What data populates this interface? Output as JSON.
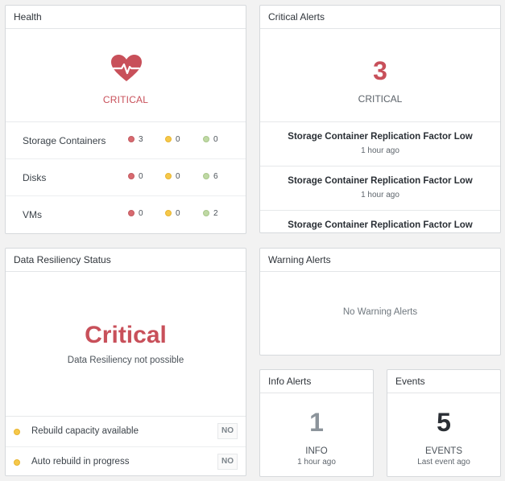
{
  "health": {
    "title": "Health",
    "status": "CRITICAL",
    "rows": [
      {
        "label": "Storage Containers",
        "critical": "3",
        "warning": "0",
        "ok": "0"
      },
      {
        "label": "Disks",
        "critical": "0",
        "warning": "0",
        "ok": "6"
      },
      {
        "label": "VMs",
        "critical": "0",
        "warning": "0",
        "ok": "2"
      }
    ]
  },
  "critical_alerts": {
    "title": "Critical Alerts",
    "count": "3",
    "count_label": "CRITICAL",
    "items": [
      {
        "title": "Storage Container Replication Factor Low",
        "time": "1 hour ago"
      },
      {
        "title": "Storage Container Replication Factor Low",
        "time": "1 hour ago"
      },
      {
        "title": "Storage Container Replication Factor Low",
        "time": ""
      }
    ]
  },
  "data_resiliency": {
    "title": "Data Resiliency Status",
    "status": "Critical",
    "subtitle": "Data Resiliency not possible",
    "rows": [
      {
        "label": "Rebuild capacity available",
        "value": "NO"
      },
      {
        "label": "Auto rebuild in progress",
        "value": "NO"
      }
    ]
  },
  "warning_alerts": {
    "title": "Warning Alerts",
    "message": "No Warning Alerts"
  },
  "info_alerts": {
    "title": "Info Alerts",
    "count": "1",
    "label": "INFO",
    "time": "1 hour ago"
  },
  "events": {
    "title": "Events",
    "count": "5",
    "label": "EVENTS",
    "time": "Last event ago"
  },
  "colors": {
    "critical": "#c8505a",
    "warning": "#f6c84a",
    "ok": "#bfd9a4"
  },
  "icons": {
    "health": "heart-pulse-icon"
  }
}
